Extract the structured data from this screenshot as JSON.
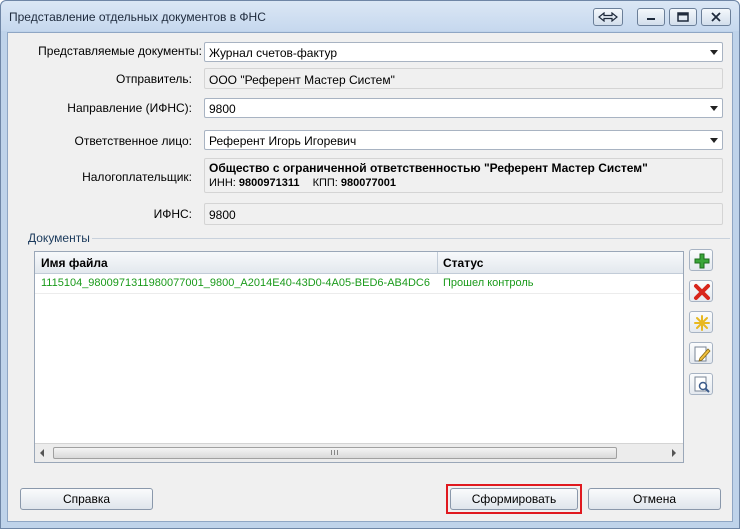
{
  "window": {
    "title": "Представление отдельных документов в ФНС",
    "controls": {
      "minimize": "minimize-icon",
      "maximize": "maximize-icon",
      "close": "close-icon",
      "restore": "restore-arrows-icon"
    }
  },
  "form": {
    "docs_label": "Представляемые документы:",
    "docs_value": "Журнал счетов-фактур",
    "sender_label": "Отправитель:",
    "sender_value": "ООО \"Референт Мастер Систем\"",
    "direction_label": "Направление (ИФНС):",
    "direction_value": "9800",
    "responsible_label": "Ответственное лицо:",
    "responsible_value": "Референт Игорь Игоревич",
    "taxpayer_label": "Налогоплательщик:",
    "taxpayer_name": "Общество с ограниченной ответственностью \"Референт Мастер Систем\"",
    "inn_label": "ИНН:",
    "inn_value": "9800971311",
    "kpp_label": "КПП:",
    "kpp_value": "980077001",
    "ifns_label": "ИФНС:",
    "ifns_value": "9800"
  },
  "documents": {
    "group_label": "Документы",
    "columns": [
      "Имя файла",
      "Статус"
    ],
    "rows": [
      {
        "file": "1115104_9800971311980077001_9800_A2014E40-43D0-4A05-BED6-AB4DC6",
        "status": "Прошел контроль"
      }
    ],
    "scroll_grip": "III",
    "side_buttons": [
      "add-icon",
      "delete-icon",
      "clear-icon",
      "edit-icon",
      "view-icon"
    ]
  },
  "colors": {
    "status_ok": "#1a9a1a",
    "highlight": "#e0191f",
    "window_frame": "#bfd3ea"
  },
  "footer": {
    "help_label": "Справка",
    "generate_label": "Сформировать",
    "cancel_label": "Отмена"
  }
}
